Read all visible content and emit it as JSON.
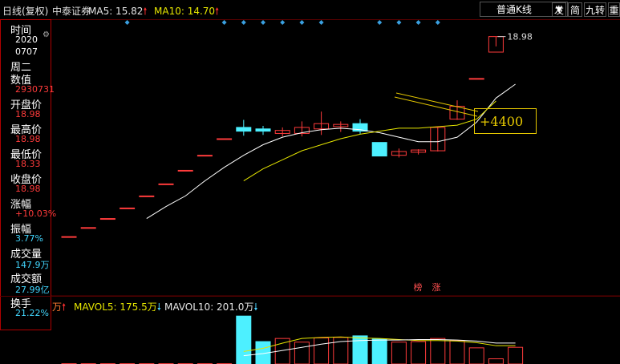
{
  "header": {
    "chart_mode": "日线(复权)",
    "stock_name": "中泰证券",
    "ma5_label": "MA5: 15.82",
    "ma10_label": "MA10: 14.70",
    "period_select": "普通K线",
    "buttons": [
      "发",
      "简",
      "九转",
      "重"
    ]
  },
  "left_panel": [
    {
      "label": "时间",
      "values": [
        "2020",
        "0707"
      ],
      "color": "#ffffff"
    },
    {
      "label": "周二",
      "values": [],
      "color": "#ffffff"
    },
    {
      "label": "数值",
      "values": [
        "2930731"
      ],
      "color": "#ff3b3b"
    },
    {
      "label": "开盘价",
      "values": [
        "18.98"
      ],
      "color": "#ff3b3b"
    },
    {
      "label": "最高价",
      "values": [
        "18.98"
      ],
      "color": "#ff3b3b"
    },
    {
      "label": "最低价",
      "values": [
        "18.33"
      ],
      "color": "#ff3b3b"
    },
    {
      "label": "收盘价",
      "values": [
        "18.98"
      ],
      "color": "#ff3b3b"
    },
    {
      "label": "涨幅",
      "values": [
        "+10.03%"
      ],
      "color": "#ff3b3b"
    },
    {
      "label": "振幅",
      "values": [
        "3.77%"
      ],
      "color": "#42d7ff"
    },
    {
      "label": "成交量",
      "values": [
        "147.9万"
      ],
      "color": "#42d7ff"
    },
    {
      "label": "成交额",
      "values": [
        "27.99亿"
      ],
      "color": "#42d7ff"
    },
    {
      "label": "换手",
      "values": [
        "21.22%"
      ],
      "color": "#42d7ff"
    }
  ],
  "volume_header": {
    "unit": "万",
    "mavol5": "MAVOL5: 175.5万",
    "mavol10": "MAVOL10: 201.0万"
  },
  "annotation_text": "+4400",
  "max_price_label": "18.98",
  "badges": [
    "榜",
    "涨"
  ],
  "colors": {
    "up": "#ff3b3b",
    "down": "#4df0ff",
    "ma5": "#ffffff",
    "ma10": "#e6e600",
    "diamond": "#3aa0e0"
  },
  "chart_data": {
    "type": "candlestick",
    "price_range": [
      4.8,
      19.6
    ],
    "ohlc": [
      [
        5.7,
        5.7,
        5.7,
        5.7
      ],
      [
        6.3,
        6.3,
        6.3,
        6.3
      ],
      [
        6.9,
        6.9,
        6.9,
        6.9
      ],
      [
        7.6,
        7.6,
        7.6,
        7.6
      ],
      [
        8.4,
        8.4,
        8.4,
        8.4
      ],
      [
        9.2,
        9.2,
        9.2,
        9.2
      ],
      [
        10.1,
        10.1,
        10.1,
        10.1
      ],
      [
        11.1,
        11.1,
        11.1,
        11.1
      ],
      [
        12.2,
        12.2,
        12.2,
        12.2
      ],
      [
        12.95,
        13.45,
        12.4,
        12.7
      ],
      [
        12.85,
        13.05,
        12.45,
        12.7
      ],
      [
        12.55,
        12.95,
        12.35,
        12.75
      ],
      [
        12.55,
        13.35,
        12.35,
        12.95
      ],
      [
        12.85,
        14.0,
        12.45,
        13.2
      ],
      [
        13.0,
        13.35,
        12.65,
        13.15
      ],
      [
        13.2,
        13.5,
        12.5,
        12.7
      ],
      [
        11.95,
        11.95,
        11.05,
        11.05
      ],
      [
        11.1,
        11.55,
        10.95,
        11.35
      ],
      [
        11.3,
        11.5,
        11.15,
        11.45
      ],
      [
        11.4,
        12.95,
        11.35,
        12.95
      ],
      [
        13.5,
        14.75,
        13.45,
        14.35
      ],
      [
        16.2,
        16.2,
        16.2,
        16.2
      ],
      [
        17.95,
        18.98,
        18.33,
        18.98
      ]
    ],
    "ma5": [
      null,
      null,
      null,
      null,
      6.9,
      7.7,
      8.4,
      9.4,
      10.3,
      11.1,
      11.8,
      12.3,
      12.6,
      12.8,
      12.9,
      12.8,
      12.6,
      12.3,
      12.0,
      12.0,
      12.3,
      13.3,
      14.9,
      15.82
    ],
    "ma10": [
      null,
      null,
      null,
      null,
      null,
      null,
      null,
      null,
      null,
      9.4,
      10.2,
      10.8,
      11.4,
      11.8,
      12.2,
      12.5,
      12.7,
      12.9,
      12.9,
      13.0,
      13.1,
      13.5,
      14.7
    ],
    "volume": [
      3,
      3,
      3,
      3,
      3,
      3,
      3,
      3,
      3,
      460,
      215,
      245,
      210,
      250,
      255,
      270,
      240,
      210,
      215,
      245,
      225,
      155,
      50,
      160
    ],
    "mavol5": [
      null,
      null,
      null,
      null,
      null,
      null,
      null,
      null,
      null,
      120,
      150,
      200,
      245,
      255,
      260,
      250,
      245,
      235,
      225,
      225,
      220,
      205,
      175.5,
      175.5
    ],
    "mavol10": [
      null,
      null,
      null,
      null,
      null,
      null,
      null,
      null,
      null,
      80,
      100,
      130,
      160,
      190,
      215,
      225,
      230,
      230,
      235,
      235,
      230,
      220,
      201.0,
      201.0
    ]
  }
}
